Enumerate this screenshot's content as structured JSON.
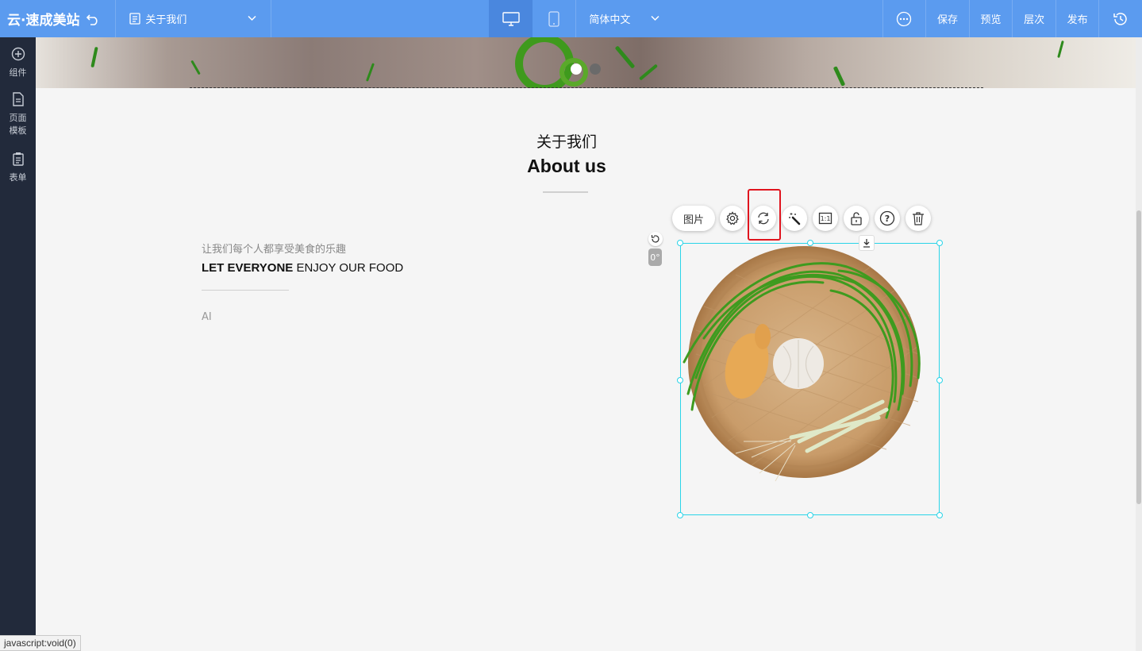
{
  "topbar": {
    "logo": "云·速成美站",
    "page_name": "关于我们",
    "language": "简体中文",
    "buttons": {
      "save": "保存",
      "preview": "预览",
      "layers": "层次",
      "publish": "发布"
    }
  },
  "sidebar": {
    "items": [
      {
        "label": "组件",
        "icon": "plus-circle-icon"
      },
      {
        "label": "页面\n模板",
        "line1": "页面",
        "line2": "模板",
        "icon": "page-icon"
      },
      {
        "label": "表单",
        "icon": "clipboard-icon"
      }
    ]
  },
  "section": {
    "title_cn": "关于我们",
    "title_en": "About us",
    "subtitle_cn": "让我们每个人都享受美食的乐趣",
    "subtitle_en_bold": "LET EVERYONE",
    "subtitle_en_rest": " ENJOY OUR FOOD",
    "body": "AI"
  },
  "image_toolbar": {
    "picture_label": "图片",
    "tools": [
      "settings-icon",
      "replace-icon",
      "magic-wand-icon",
      "ratio-icon",
      "lock-icon",
      "help-icon",
      "delete-icon"
    ],
    "ratio_text": "1:1",
    "help_text": "?"
  },
  "rotation": {
    "degree": "0°"
  },
  "status": "javascript:void(0)",
  "colors": {
    "topbar": "#5b9bef",
    "sidebar": "#222a3b",
    "selection": "#2ad4e8",
    "highlight": "#e0141e"
  }
}
